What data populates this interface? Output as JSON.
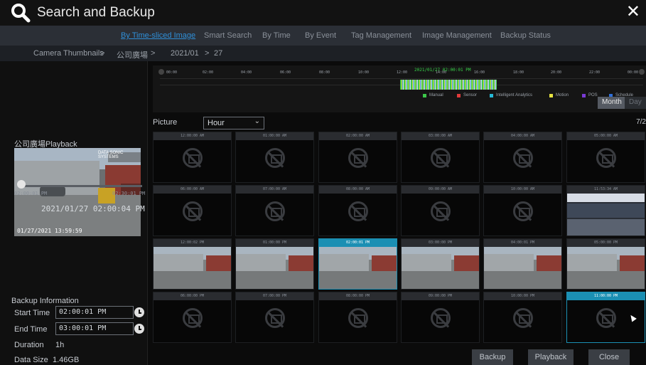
{
  "window": {
    "title": "Search and Backup",
    "close_label": "✕"
  },
  "tabs": [
    {
      "label": "By Time-sliced Image",
      "active": true
    },
    {
      "label": "Smart Search",
      "active": false
    },
    {
      "label": "By Time",
      "active": false
    },
    {
      "label": "By Event",
      "active": false
    },
    {
      "label": "Tag Management",
      "active": false
    },
    {
      "label": "Image Management",
      "active": false
    },
    {
      "label": "Backup Status",
      "active": false
    }
  ],
  "breadcrumb": {
    "items": [
      "Camera Thumbnails",
      "公司廣場",
      "2021/01",
      "27"
    ],
    "separator": ">"
  },
  "playback": {
    "title": "公司廣場Playback",
    "osd_time": "01/27/2021 13:59:59",
    "camera_tag": "DATA SONIC SYSTEMS",
    "slider_start": "02:00:01 PM",
    "slider_end": "02:30:01 PM",
    "slider_position": 0.0,
    "current_time": "2021/01/27 02:00:04 PM"
  },
  "backup": {
    "heading": "Backup Information",
    "start_label": "Start Time",
    "start_value": "02:00:01 PM",
    "end_label": "End Time",
    "end_value": "03:00:01 PM",
    "duration_label": "Duration",
    "duration_value": "1h",
    "size_label": "Data Size",
    "size_value": "1.46GB"
  },
  "timeline": {
    "hours": [
      "00:00",
      "02:00",
      "04:00",
      "06:00",
      "08:00",
      "10:00",
      "12:00",
      "14:00",
      "16:00",
      "18:00",
      "20:00",
      "22:00",
      "00:00"
    ],
    "cursor_label": "2021/01/27 02:00:01 PM",
    "legend": [
      {
        "label": "Manual",
        "color": "#3cc84a"
      },
      {
        "label": "Sensor",
        "color": "#e03a3a"
      },
      {
        "label": "Intelligent Analytics",
        "color": "#26b8d6"
      },
      {
        "label": "Motion",
        "color": "#e6e240"
      },
      {
        "label": "POS",
        "color": "#7a3ad6"
      },
      {
        "label": "Schedule",
        "color": "#2f6fd8"
      }
    ],
    "month_label": "Month",
    "day_label": "Day"
  },
  "picture": {
    "label": "Picture",
    "interval": "Hour",
    "page": "7/2"
  },
  "grid": [
    {
      "time": "12:00:00 AM",
      "image": false
    },
    {
      "time": "01:00:00 AM",
      "image": false
    },
    {
      "time": "02:00:00 AM",
      "image": false
    },
    {
      "time": "03:00:00 AM",
      "image": false
    },
    {
      "time": "04:00:00 AM",
      "image": false
    },
    {
      "time": "05:00:00 AM",
      "image": false
    },
    {
      "time": "06:00:00 AM",
      "image": false
    },
    {
      "time": "07:00:00 AM",
      "image": false
    },
    {
      "time": "08:00:00 AM",
      "image": false
    },
    {
      "time": "09:00:00 AM",
      "image": false
    },
    {
      "time": "10:00:00 AM",
      "image": false
    },
    {
      "time": "11:53:34 AM",
      "image": "indoor"
    },
    {
      "time": "12:00:02 PM",
      "image": "outdoor"
    },
    {
      "time": "01:00:00 PM",
      "image": "outdoor"
    },
    {
      "time": "02:00:01 PM",
      "image": "outdoor",
      "selected": true
    },
    {
      "time": "03:00:00 PM",
      "image": "outdoor"
    },
    {
      "time": "04:00:01 PM",
      "image": "outdoor"
    },
    {
      "time": "05:00:00 PM",
      "image": "outdoor"
    },
    {
      "time": "06:00:00 PM",
      "image": false
    },
    {
      "time": "07:00:00 PM",
      "image": false
    },
    {
      "time": "08:00:00 PM",
      "image": false
    },
    {
      "time": "09:00:00 PM",
      "image": false
    },
    {
      "time": "10:00:00 PM",
      "image": false
    },
    {
      "time": "11:00:00 PM",
      "image": false,
      "selected": true
    }
  ],
  "buttons": {
    "backup": "Backup",
    "playback": "Playback",
    "close": "Close"
  }
}
